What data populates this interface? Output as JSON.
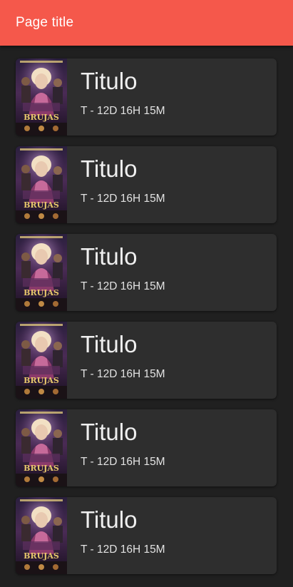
{
  "appbar": {
    "title": "Page title",
    "color": "#f5584b"
  },
  "list": {
    "items": [
      {
        "title": "Titulo",
        "subtitle": "T - 12D 16H 15M",
        "poster_caption": "BRUJAS"
      },
      {
        "title": "Titulo",
        "subtitle": "T - 12D 16H 15M",
        "poster_caption": "BRUJAS"
      },
      {
        "title": "Titulo",
        "subtitle": "T - 12D 16H 15M",
        "poster_caption": "BRUJAS"
      },
      {
        "title": "Titulo",
        "subtitle": "T - 12D 16H 15M",
        "poster_caption": "BRUJAS"
      },
      {
        "title": "Titulo",
        "subtitle": "T - 12D 16H 15M",
        "poster_caption": "BRUJAS"
      },
      {
        "title": "Titulo",
        "subtitle": "T - 12D 16H 15M",
        "poster_caption": "BRUJAS"
      }
    ]
  }
}
